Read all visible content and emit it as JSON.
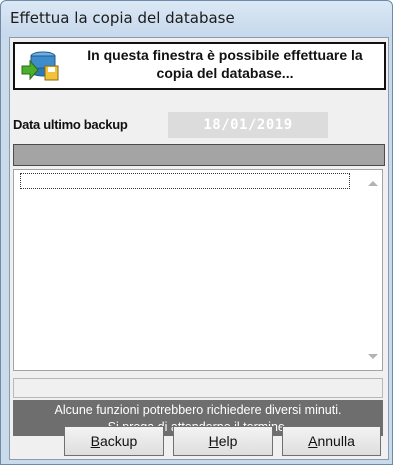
{
  "window": {
    "title": "Effettua la copia del database"
  },
  "header": {
    "icon": "database-backup-icon",
    "line1": "In questa finestra è possibile effettuare la",
    "line2": "copia del database..."
  },
  "backup": {
    "date_label": "Data ultimo backup",
    "date_value": "18/01/2019"
  },
  "notice": {
    "line1": "Alcune funzioni potrebbero richiedere diversi minuti.",
    "line2": "Si prega di attenderne il termine."
  },
  "buttons": {
    "backup": {
      "mnemonic": "B",
      "rest": "ackup"
    },
    "help": {
      "mnemonic": "H",
      "rest": "elp"
    },
    "cancel": {
      "mnemonic": "A",
      "rest": "nnulla"
    }
  }
}
